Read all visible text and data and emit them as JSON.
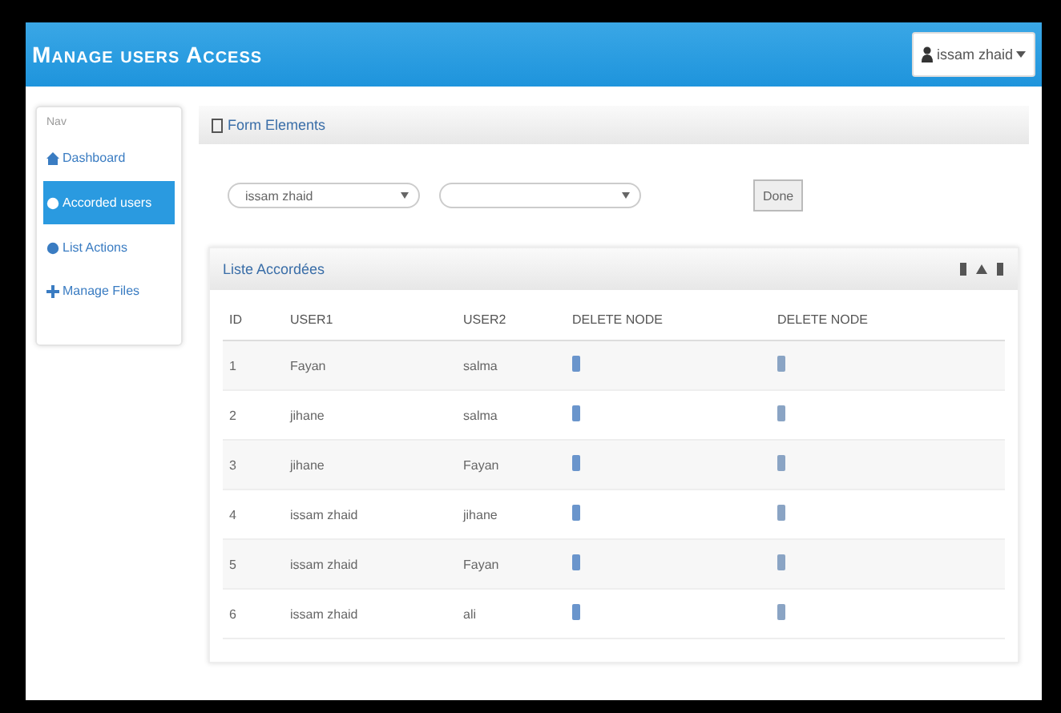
{
  "header": {
    "title": "Manage users Access",
    "user_menu": "issam zhaid"
  },
  "sidebar": {
    "heading": "Nav",
    "items": [
      {
        "label": "Dashboard",
        "selected": false
      },
      {
        "label": "Accorded users",
        "selected": true
      },
      {
        "label": "List Actions",
        "selected": false
      },
      {
        "label": "Manage Files",
        "selected": false
      }
    ]
  },
  "form_panel": {
    "title": "Form Elements",
    "select_1": "issam zhaid",
    "button": "Done"
  },
  "list_panel": {
    "title": "Liste Accordées",
    "table": {
      "columns": [
        "ID",
        "USER1",
        "USER2",
        "DELETE NODE",
        "DELETE NODE"
      ],
      "rows": [
        {
          "id": "1",
          "user1": "Fayan",
          "user2": "salma"
        },
        {
          "id": "2",
          "user1": "jihane",
          "user2": "salma"
        },
        {
          "id": "3",
          "user1": "jihane",
          "user2": "Fayan"
        },
        {
          "id": "4",
          "user1": "issam zhaid",
          "user2": "jihane"
        },
        {
          "id": "5",
          "user1": "issam zhaid",
          "user2": "Fayan"
        },
        {
          "id": "6",
          "user1": "issam zhaid",
          "user2": "ali"
        }
      ]
    }
  }
}
